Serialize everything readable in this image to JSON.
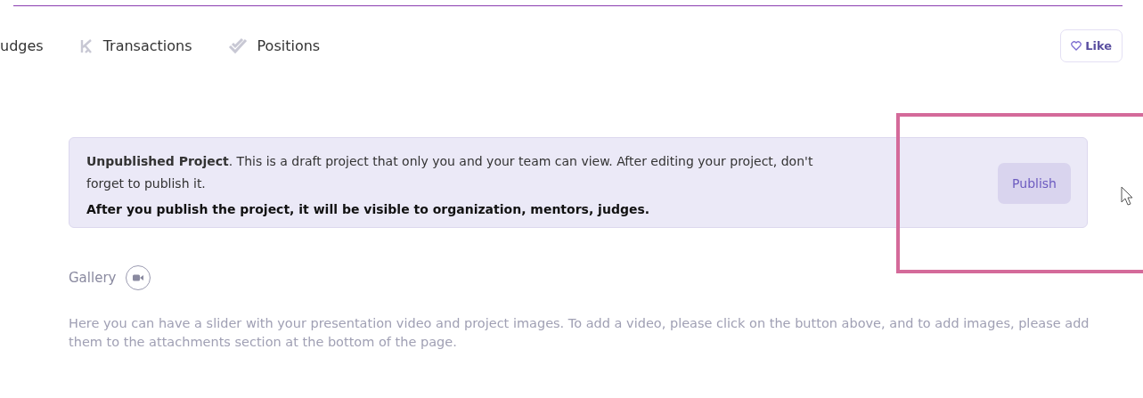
{
  "nav": [
    {
      "label": "udges"
    },
    {
      "label": "Transactions"
    },
    {
      "label": "Positions"
    }
  ],
  "like_button": {
    "label": "Like"
  },
  "notice": {
    "text": "**Unpublished Project**. This is a draft project that only you and your team can view. After editing your project, don't forget to publish it.",
    "note": "After you publish the project, it will be visible to organization, mentors, judges.",
    "button": "Publish"
  },
  "gallery": {
    "title": "Gallery",
    "description": "Here you can have a slider with your presentation video and project images. To add a video, please click on the button above, and to add images, please add them to the attachments section at the bottom of the page."
  }
}
